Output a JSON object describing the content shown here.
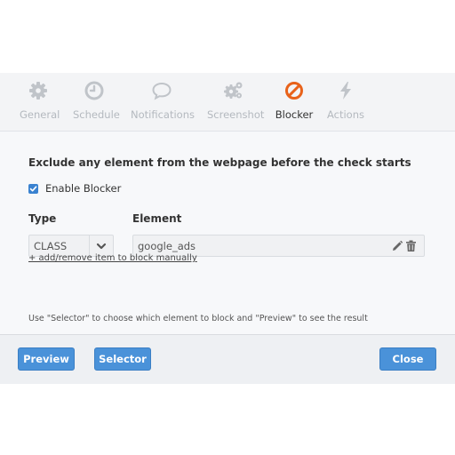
{
  "tabs": [
    {
      "label": "General",
      "icon": "gear-icon"
    },
    {
      "label": "Schedule",
      "icon": "clock-icon"
    },
    {
      "label": "Notifications",
      "icon": "speech-bubble-icon"
    },
    {
      "label": "Screenshot",
      "icon": "gears-icon"
    },
    {
      "label": "Blocker",
      "icon": "block-icon",
      "active": true
    },
    {
      "label": "Actions",
      "icon": "lightning-icon"
    }
  ],
  "blocker": {
    "heading": "Exclude any element from the webpage before the check starts",
    "enable_label": "Enable Blocker",
    "enabled": true,
    "type_header": "Type",
    "element_header": "Element",
    "type_value": "CLASS",
    "element_value": "google_ads",
    "add_link": "+ add/remove item to block manually",
    "hint": "Use \"Selector\" to choose which element to block and \"Preview\" to see the result"
  },
  "footer": {
    "preview_label": "Preview",
    "selector_label": "Selector",
    "close_label": "Close"
  },
  "colors": {
    "accent": "#4a92d9",
    "active_tab_icon": "#e8621a",
    "inactive_tab": "#b4b9bf"
  }
}
